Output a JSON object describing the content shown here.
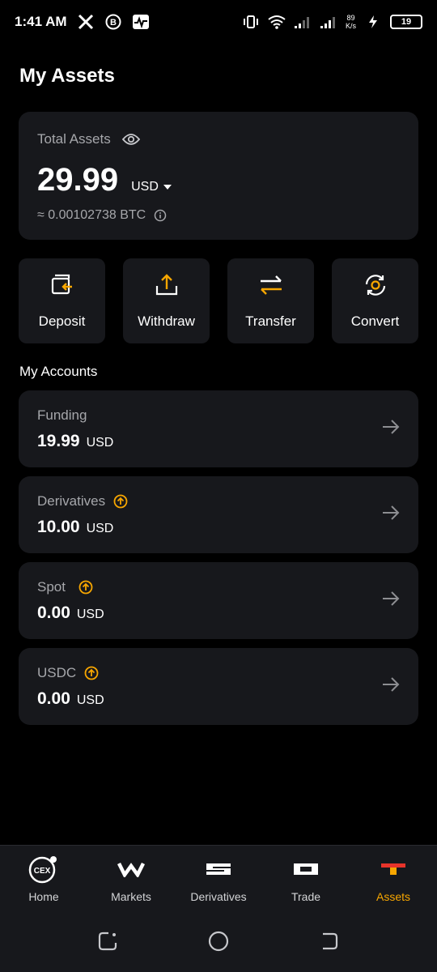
{
  "status_bar": {
    "time": "1:41 AM",
    "net_speed_top": "89",
    "net_speed_unit": "K/s",
    "battery": "19"
  },
  "page": {
    "title": "My Assets"
  },
  "total": {
    "label": "Total Assets",
    "amount": "29.99",
    "currency": "USD",
    "btc": "≈ 0.00102738 BTC"
  },
  "actions": [
    {
      "label": "Deposit",
      "icon": "deposit-icon"
    },
    {
      "label": "Withdraw",
      "icon": "withdraw-icon"
    },
    {
      "label": "Transfer",
      "icon": "transfer-icon"
    },
    {
      "label": "Convert",
      "icon": "convert-icon"
    }
  ],
  "accounts_title": "My Accounts",
  "accounts": [
    {
      "name": "Funding",
      "amount": "19.99",
      "currency": "USD",
      "upgrade": false
    },
    {
      "name": "Derivatives",
      "amount": "10.00",
      "currency": "USD",
      "upgrade": true
    },
    {
      "name": "Spot",
      "amount": "0.00",
      "currency": "USD",
      "upgrade": true
    },
    {
      "name": "USDC",
      "amount": "0.00",
      "currency": "USD",
      "upgrade": true
    }
  ],
  "nav": [
    {
      "label": "Home",
      "icon_text": "CEX"
    },
    {
      "label": "Markets"
    },
    {
      "label": "Derivatives"
    },
    {
      "label": "Trade"
    },
    {
      "label": "Assets",
      "active": true
    }
  ],
  "colors": {
    "accent": "#f7a600",
    "card": "#17181c",
    "muted": "#a6a7ab"
  }
}
